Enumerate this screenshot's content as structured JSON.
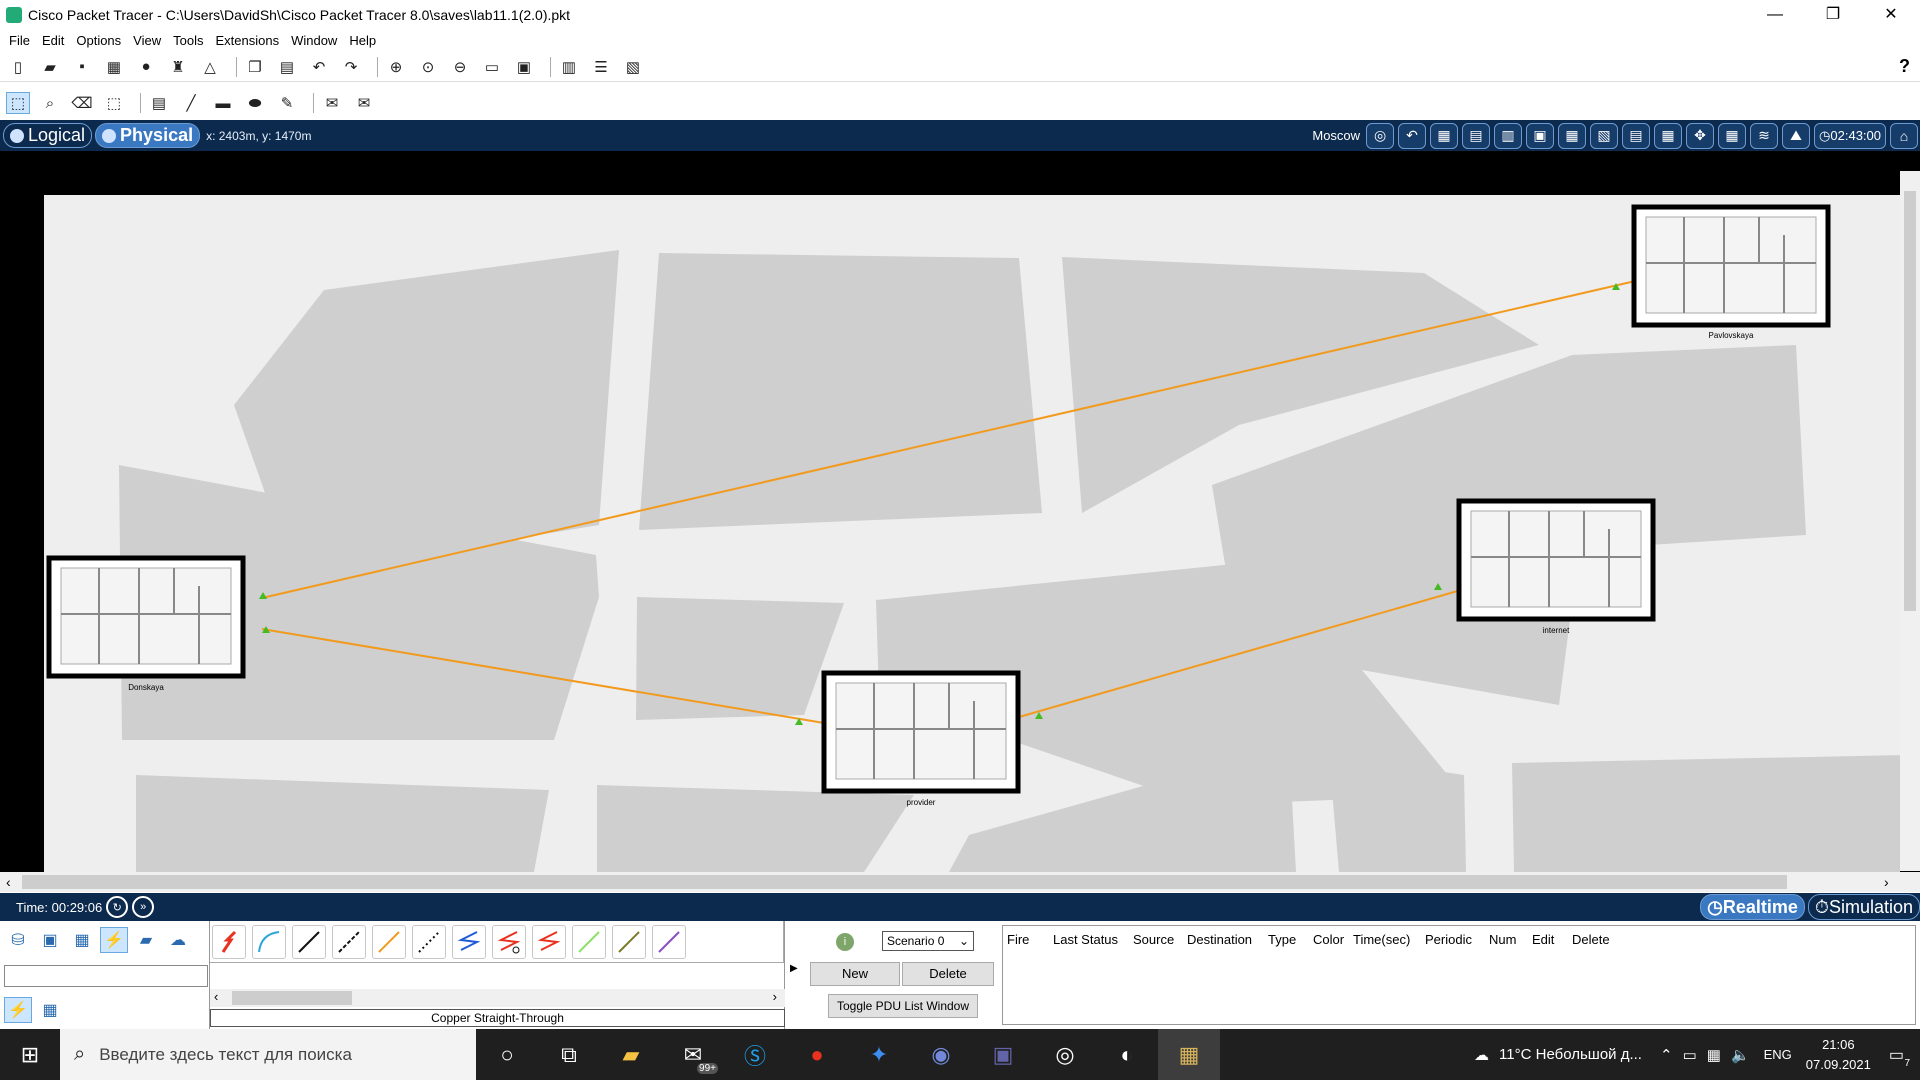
{
  "window": {
    "title": "Cisco Packet Tracer - C:\\Users\\DavidSh\\Cisco Packet Tracer 8.0\\saves\\lab11.1(2.0).pkt",
    "minimize": "—",
    "restore": "❐",
    "close": "✕"
  },
  "menu": [
    "File",
    "Edit",
    "Options",
    "View",
    "Tools",
    "Extensions",
    "Window",
    "Help"
  ],
  "help": "?",
  "nav": {
    "logical_label": "Logical",
    "physical_label": "Physical",
    "coords": "x: 2403m, y: 1470m",
    "city": "Moscow",
    "clock": "02:43:00"
  },
  "buildings": [
    {
      "name": "Pavlovskaya"
    },
    {
      "name": "Donskaya"
    },
    {
      "name": "internet"
    },
    {
      "name": "provider"
    }
  ],
  "timebar": {
    "time": "Time: 00:29:06",
    "realtime": "Realtime",
    "simulation": "Simulation"
  },
  "connections": {
    "selected_label": "Copper Straight-Through"
  },
  "pdu": {
    "scenario": "Scenario 0",
    "new": "New",
    "delete": "Delete",
    "toggle": "Toggle PDU List Window",
    "info_icon": "i",
    "columns": [
      "Fire",
      "Last Status",
      "Source",
      "Destination",
      "Type",
      "Color",
      "Time(sec)",
      "Periodic",
      "Num",
      "Edit",
      "Delete"
    ]
  },
  "taskbar": {
    "search_placeholder": "Введите здесь текст для поиска",
    "mail_badge": "99+",
    "weather": "11°C  Небольшой д...",
    "lang": "ENG",
    "time": "21:06",
    "date": "07.09.2021",
    "notif_count": "7"
  },
  "colors": {
    "link": "#f29a1e",
    "link_end": "#44bb22",
    "nav_bg": "#0b2a4d"
  }
}
